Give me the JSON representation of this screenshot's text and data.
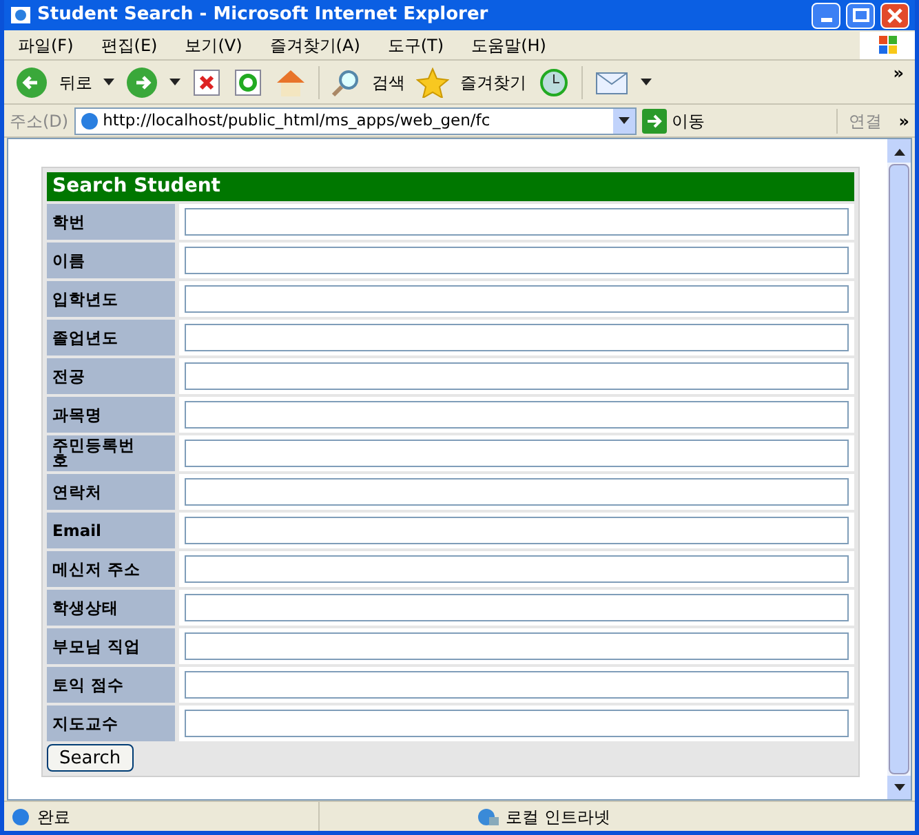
{
  "window": {
    "title": "Student Search - Microsoft Internet Explorer"
  },
  "menu": [
    "파일(F)",
    "편집(E)",
    "보기(V)",
    "즐겨찾기(A)",
    "도구(T)",
    "도움말(H)"
  ],
  "toolbar": {
    "back": "뒤로",
    "search": "검색",
    "favorites": "즐겨찾기",
    "more": "»"
  },
  "address_bar": {
    "label": "주소(D)",
    "value": "http://localhost/public_html/ms_apps/web_gen/fc",
    "go": "이동",
    "links": "연결",
    "more": "»"
  },
  "form": {
    "title": "Search Student",
    "fields": [
      {
        "label": "학번"
      },
      {
        "label": "이름"
      },
      {
        "label": "입학년도"
      },
      {
        "label": "졸업년도"
      },
      {
        "label": "전공"
      },
      {
        "label": "과목명"
      },
      {
        "label": "주민등록번호"
      },
      {
        "label": "연락처"
      },
      {
        "label": "Email"
      },
      {
        "label": "메신저 주소"
      },
      {
        "label": "학생상태"
      },
      {
        "label": "부모님 직업"
      },
      {
        "label": "토익 점수"
      },
      {
        "label": "지도교수"
      }
    ],
    "button": "Search"
  },
  "status_bar": {
    "text": "완료",
    "zone": "로컬 인트라넷"
  }
}
